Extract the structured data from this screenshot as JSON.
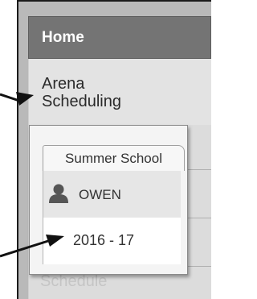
{
  "nav": {
    "home_label": "Home",
    "arena_line1": "Arena",
    "arena_line2": "Scheduling",
    "hidden_item_label": "Schedule"
  },
  "popup": {
    "tab_label": "Summer School",
    "user_icon": "person-icon",
    "user_name": "OWEN",
    "year_label": "2016 - 17"
  },
  "colors": {
    "home_background": "#747474",
    "menu_background": "#e3e3e3",
    "popup_background": "#f4f4f4",
    "annotation_arrow": "#111111"
  }
}
